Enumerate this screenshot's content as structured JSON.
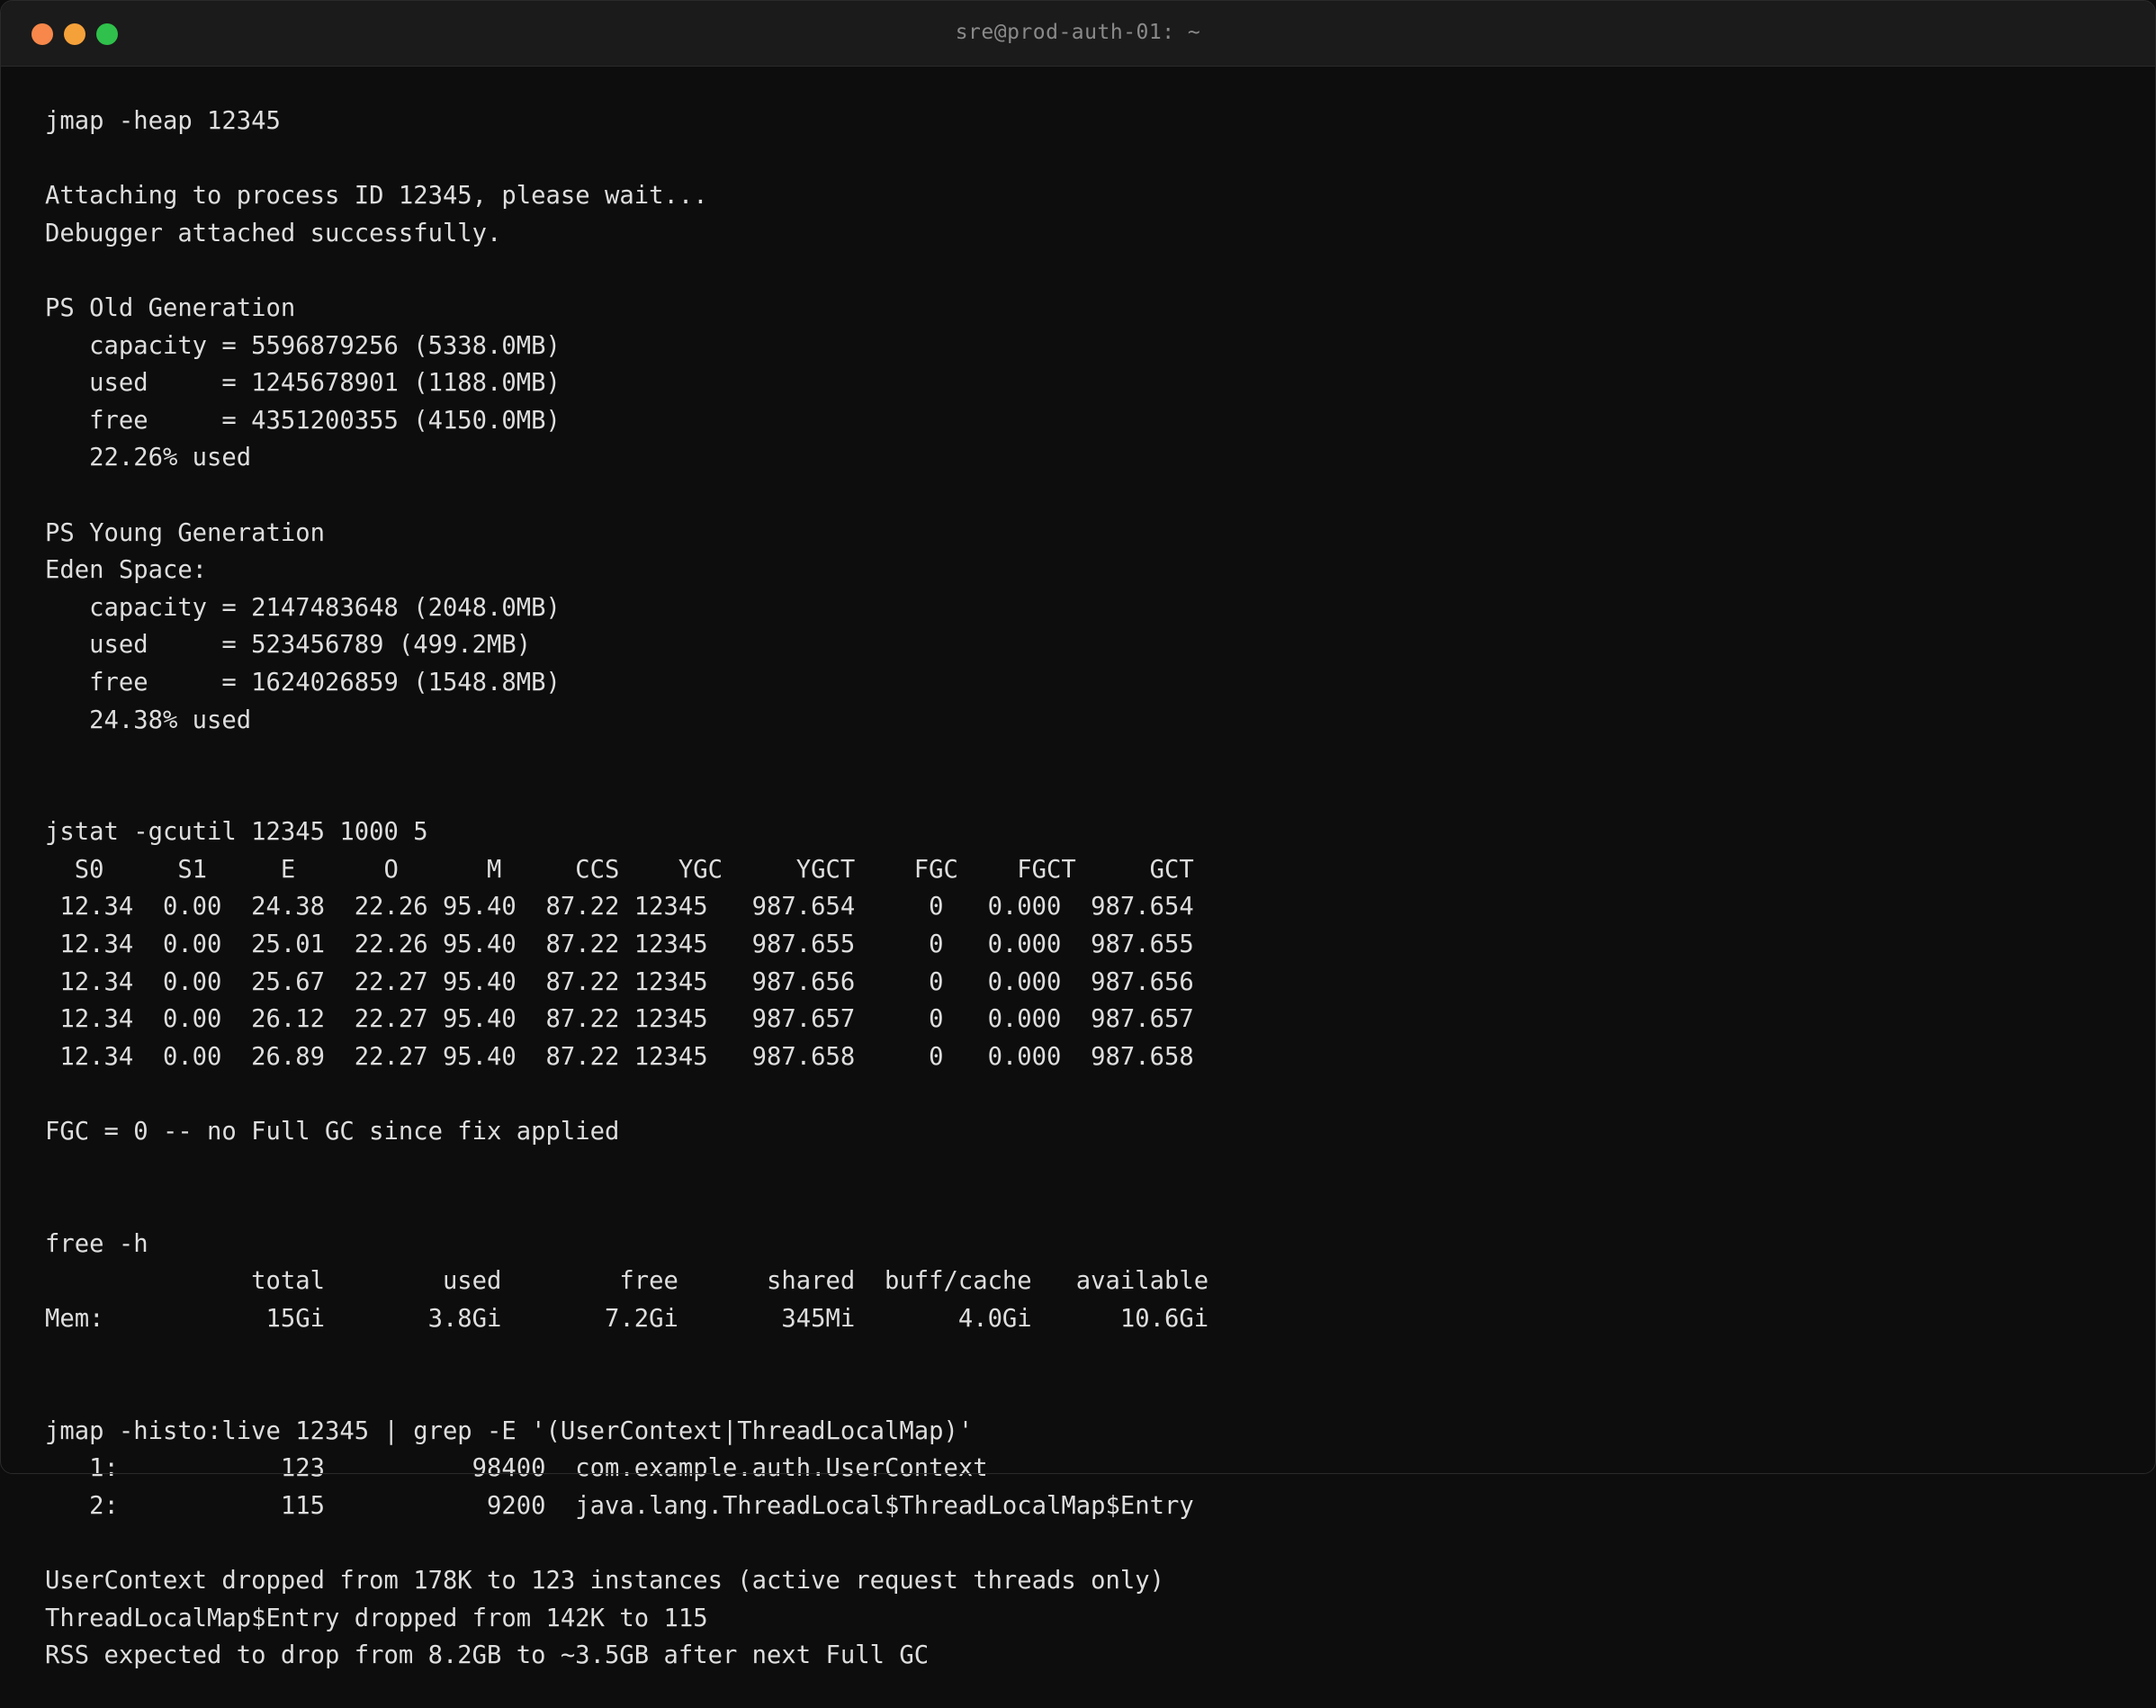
{
  "window": {
    "title": "sre@prod-auth-01: ~",
    "colors": {
      "close": "#f7874a",
      "minimize": "#f5a13a",
      "maximize": "#2fc14b",
      "background": "#0d0d0d",
      "text": "#dedede"
    }
  },
  "terminal": {
    "lines": [
      "jmap -heap 12345",
      "",
      "Attaching to process ID 12345, please wait...",
      "Debugger attached successfully.",
      "",
      "PS Old Generation",
      "   capacity = 5596879256 (5338.0MB)",
      "   used     = 1245678901 (1188.0MB)",
      "   free     = 4351200355 (4150.0MB)",
      "   22.26% used",
      "",
      "PS Young Generation",
      "Eden Space:",
      "   capacity = 2147483648 (2048.0MB)",
      "   used     = 523456789 (499.2MB)",
      "   free     = 1624026859 (1548.8MB)",
      "   24.38% used",
      "",
      "",
      "jstat -gcutil 12345 1000 5",
      "  S0     S1     E      O      M     CCS    YGC     YGCT    FGC    FGCT     GCT",
      " 12.34  0.00  24.38  22.26 95.40  87.22 12345   987.654     0   0.000  987.654",
      " 12.34  0.00  25.01  22.26 95.40  87.22 12345   987.655     0   0.000  987.655",
      " 12.34  0.00  25.67  22.27 95.40  87.22 12345   987.656     0   0.000  987.656",
      " 12.34  0.00  26.12  22.27 95.40  87.22 12345   987.657     0   0.000  987.657",
      " 12.34  0.00  26.89  22.27 95.40  87.22 12345   987.658     0   0.000  987.658",
      "",
      "FGC = 0 -- no Full GC since fix applied",
      "",
      "",
      "free -h",
      "              total        used        free      shared  buff/cache   available",
      "Mem:           15Gi       3.8Gi       7.2Gi       345Mi       4.0Gi      10.6Gi",
      "",
      "",
      "jmap -histo:live 12345 | grep -E '(UserContext|ThreadLocalMap)'",
      "   1:           123          98400  com.example.auth.UserContext",
      "   2:           115           9200  java.lang.ThreadLocal$ThreadLocalMap$Entry",
      "",
      "UserContext dropped from 178K to 123 instances (active request threads only)",
      "ThreadLocalMap$Entry dropped from 142K to 115",
      "RSS expected to drop from 8.2GB to ~3.5GB after next Full GC"
    ]
  }
}
